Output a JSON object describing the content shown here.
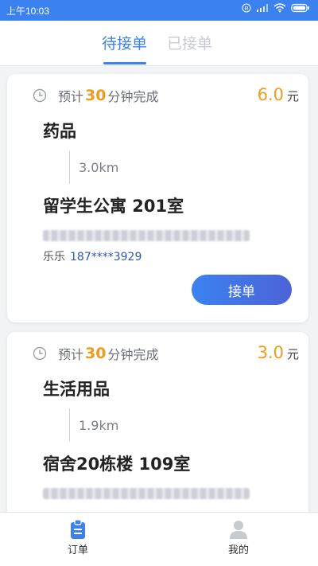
{
  "status_bar": {
    "time": "上午10:03",
    "icons": [
      "r-icon",
      "signal-icon",
      "wifi-icon",
      "battery-icon"
    ]
  },
  "tabs": [
    {
      "label": "待接单",
      "active": true
    },
    {
      "label": "已接单",
      "active": false
    }
  ],
  "orders": [
    {
      "eta_prefix": "预计",
      "eta_minutes": "30",
      "eta_suffix": "分钟完成",
      "price": "6.0",
      "currency": "元",
      "goods": "药品",
      "distance": "3.0km",
      "destination": "留学生公寓 201室",
      "contact_name": "乐乐",
      "contact_phone": "187****3929",
      "accept_label": "接单"
    },
    {
      "eta_prefix": "预计",
      "eta_minutes": "30",
      "eta_suffix": "分钟完成",
      "price": "3.0",
      "currency": "元",
      "goods": "生活用品",
      "distance": "1.9km",
      "destination": "宿舍20栋楼 109室"
    }
  ],
  "bottom_nav": [
    {
      "label": "订单",
      "icon": "clipboard-icon",
      "active": true
    },
    {
      "label": "我的",
      "icon": "user-icon",
      "active": false
    }
  ],
  "colors": {
    "primary": "#3b82f0",
    "accent_orange": "#f29a1d",
    "phone_blue": "#2f55b5"
  }
}
